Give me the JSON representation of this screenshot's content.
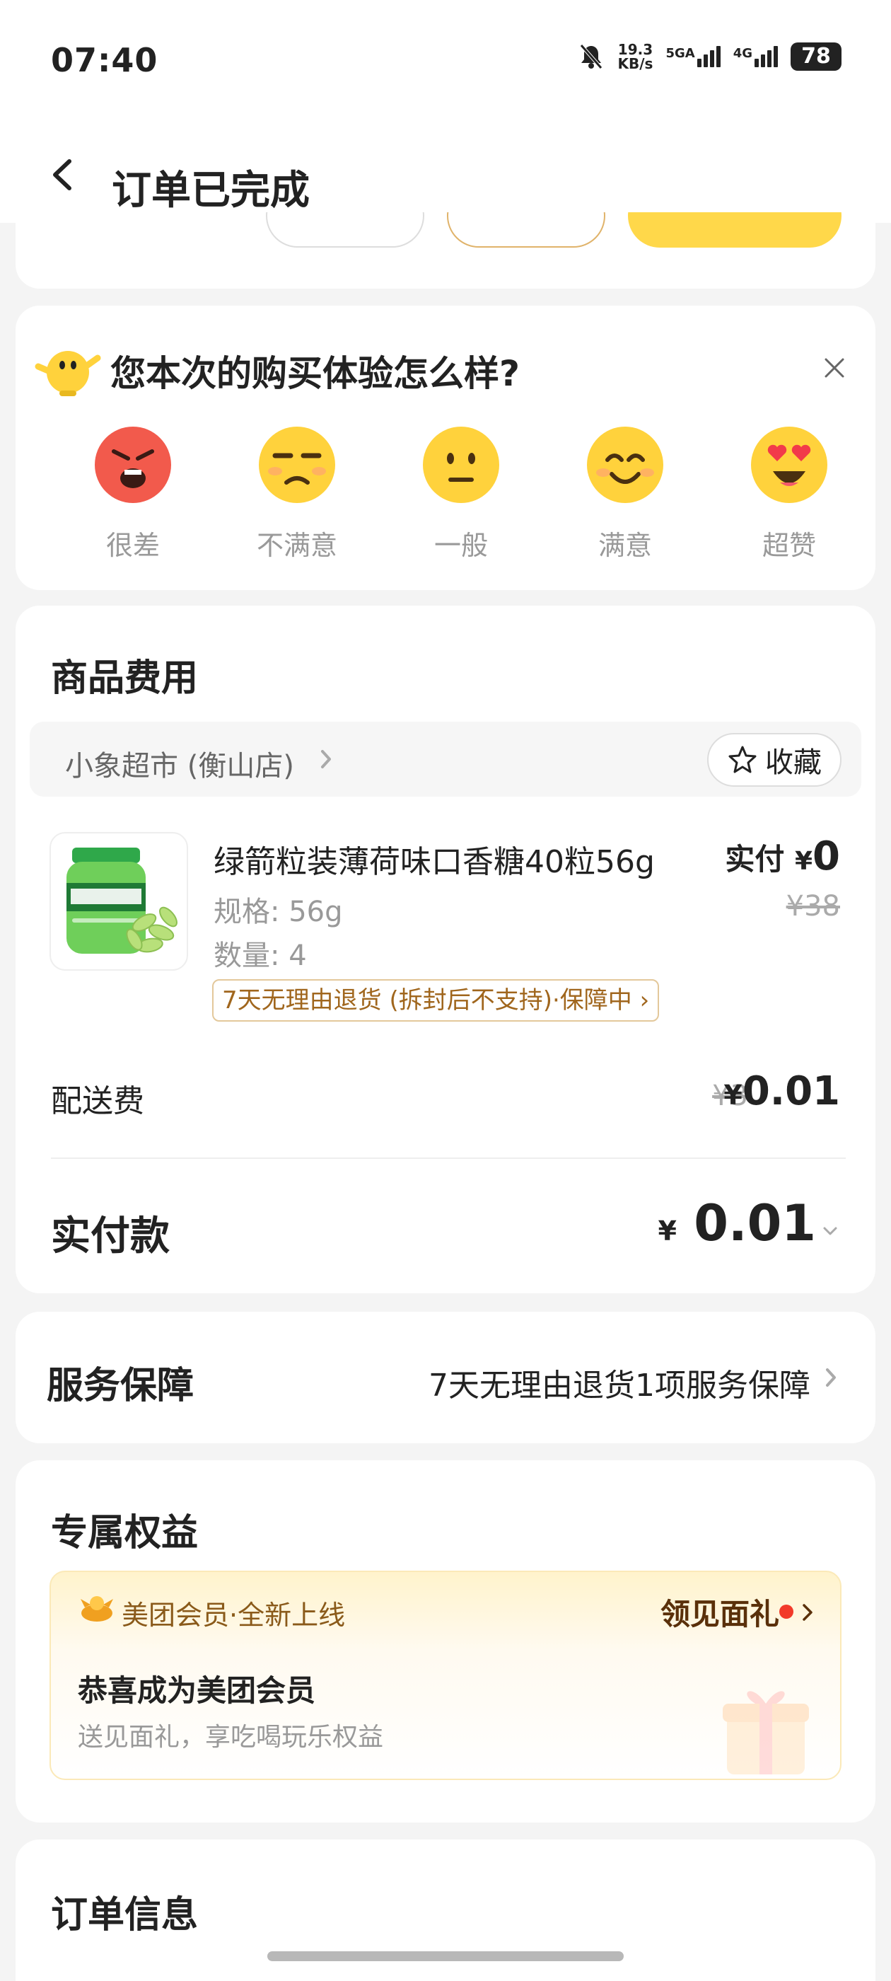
{
  "status_bar": {
    "time": "07:40",
    "net_speed_value": "19.3",
    "net_speed_unit": "KB/s",
    "sig1_label": "5GA",
    "sig2_label": "4G",
    "battery": "78"
  },
  "header": {
    "title": "订单已完成"
  },
  "feedback": {
    "question": "您本次的购买体验怎么样?",
    "options": [
      {
        "label": "很差",
        "icon": "angry-face-icon"
      },
      {
        "label": "不满意",
        "icon": "unamused-face-icon"
      },
      {
        "label": "一般",
        "icon": "neutral-face-icon"
      },
      {
        "label": "满意",
        "icon": "smiling-face-icon"
      },
      {
        "label": "超赞",
        "icon": "heart-eyes-face-icon"
      }
    ]
  },
  "goods": {
    "section_title": "商品费用",
    "store_name": "小象超市 (衡山店)",
    "favorite_label": "收藏",
    "product": {
      "name": "绿箭粒装薄荷味口香糖40粒56g",
      "spec": "规格: 56g",
      "quantity": "数量: 4",
      "pay_prefix": "实付",
      "currency": "¥",
      "paid": "0",
      "original_price": "¥38",
      "tag": "7天无理由退货 (拆封后不支持)·保障中"
    },
    "shipping_label": "配送费",
    "shipping_original": "¥3",
    "shipping_currency": "¥",
    "shipping_value": "0.01",
    "total_label": "实付款",
    "total_currency": "¥",
    "total_value": "0.01"
  },
  "service": {
    "title": "服务保障",
    "value": "7天无理由退货1项服务保障"
  },
  "benefits": {
    "title": "专属权益",
    "member_brand": "美团会员·全新上线",
    "gift_link": "领见面礼",
    "member_title": "恭喜成为美团会员",
    "member_sub": "送见面礼，享吃喝玩乐权益"
  },
  "order_info": {
    "title": "订单信息"
  },
  "colors": {
    "accent_yellow": "#ffd21e",
    "tag_brown": "#a0661d",
    "page_bg": "#f4f4f4"
  }
}
